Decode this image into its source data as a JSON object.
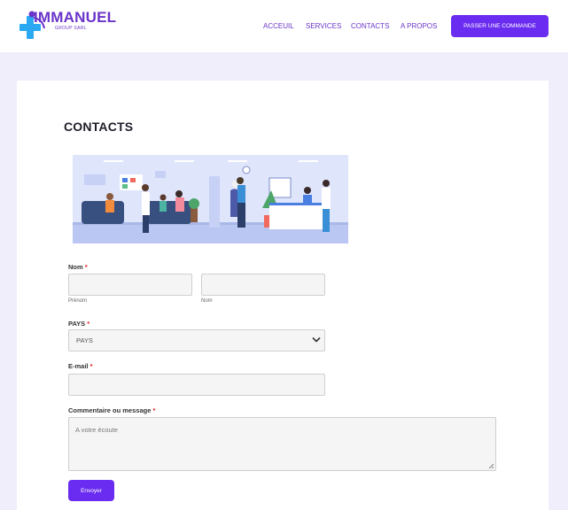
{
  "brand": {
    "name": "IMMANUEL",
    "subtitle": "GROUP SARL"
  },
  "nav": {
    "items": [
      "ACCEUIL",
      "SERVICES",
      "CONTACTS",
      "A PROPOS"
    ],
    "cta": "PASSER UNE COMMANDE"
  },
  "page": {
    "title": "CONTACTS"
  },
  "form": {
    "name_label": "Nom",
    "required_mark": "*",
    "first_name_sublabel": "Prénom",
    "last_name_sublabel": "Nom",
    "country_label": "PAYS",
    "country_value": "PAYS",
    "email_label": "E-mail",
    "message_label": "Commentaire ou message",
    "message_placeholder": "A votre écoute",
    "submit_label": "Envoyer"
  },
  "colors": {
    "accent": "#6a2cf0",
    "nav_text": "#6a34c9",
    "background": "#f1eefc",
    "cross": "#2aa9f2"
  }
}
